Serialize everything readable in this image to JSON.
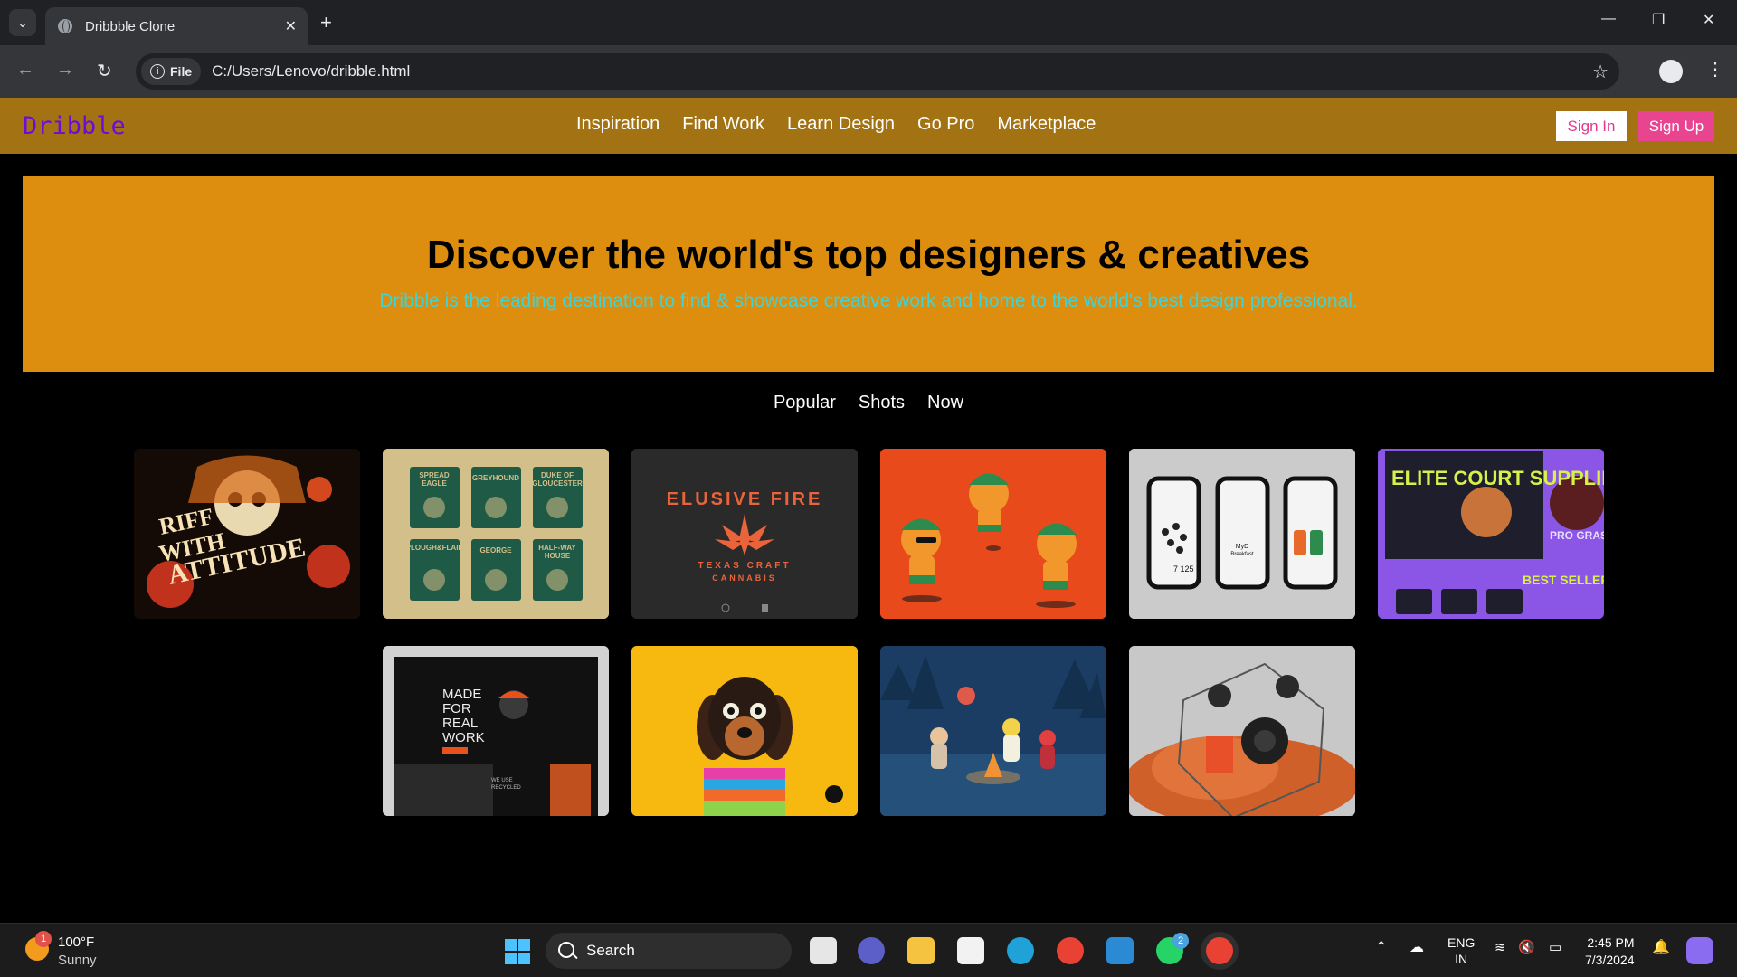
{
  "browser": {
    "tab_title": "Dribbble Clone",
    "chip_label": "File",
    "url": "C:/Users/Lenovo/dribble.html"
  },
  "site": {
    "logo": "Dribble",
    "nav": [
      "Inspiration",
      "Find Work",
      "Learn Design",
      "Go Pro",
      "Marketplace"
    ],
    "sign_in": "Sign In",
    "sign_up": "Sign Up",
    "hero_title": "Discover the world's top designers & creatives",
    "hero_subtitle": "Dribble is the leading destination to find & showcase creative work and home to the world's best design professional.",
    "filters": [
      "Popular",
      "Shots",
      "Now"
    ],
    "shots": [
      {
        "alt": "Riff with Attitude",
        "text": "RIFF WITH ATTITUDE"
      },
      {
        "alt": "Pub labels poster",
        "text": "SPREAD EAGLE · GREYHOUND · DUKE OF GLOUCESTER · PLOUGH & FLAIL · GEORGE · HALF-WAY HOUSE"
      },
      {
        "alt": "Elusive Fire cannabis logo",
        "text": "ELUSIVE FIRE · TEXAS CRAFT CANNABIS"
      },
      {
        "alt": "Cartoon dogs illustration",
        "text": ""
      },
      {
        "alt": "Mobile app screens",
        "text": "MyD Breakfast"
      },
      {
        "alt": "Elite Court Supplies",
        "text": "ELITE COURT SUPPLIES · BEST SELLER"
      },
      {
        "alt": "Made for real work website",
        "text": "MADE FOR REAL WORK"
      },
      {
        "alt": "Dachshund in sweater",
        "text": ""
      },
      {
        "alt": "Campfire night illustration",
        "text": ""
      },
      {
        "alt": "Transparent speaker render",
        "text": ""
      }
    ]
  },
  "taskbar": {
    "weather_badge": "1",
    "temperature": "100°F",
    "condition": "Sunny",
    "search": "Search",
    "whatsapp_badge": "2",
    "lang_line1": "ENG",
    "lang_line2": "IN",
    "time": "2:45 PM",
    "date": "7/3/2024"
  }
}
